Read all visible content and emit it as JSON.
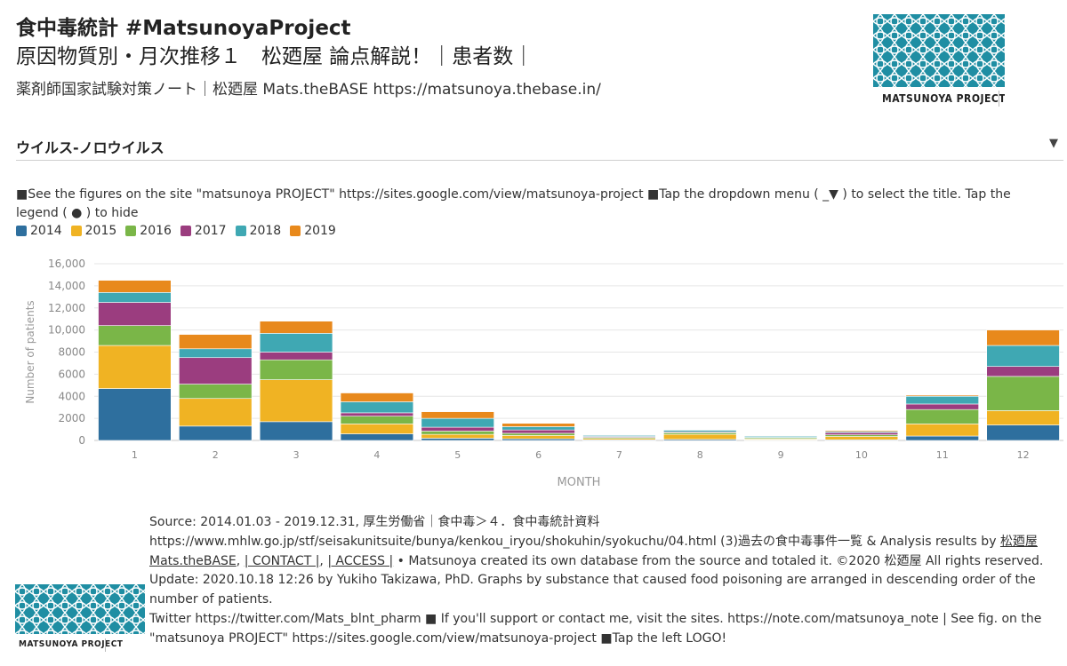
{
  "header": {
    "title1": "食中毒統計 #MatsunoyaProject",
    "title2": "原因物質別・月次推移１　松廼屋 論点解説！｜患者数｜",
    "subtitle": "薬剤師国家試験対策ノート｜松廼屋 Mats.theBASE https://matsunoya.thebase.in/"
  },
  "logo": {
    "text": "MATSUNOYA PROJECT"
  },
  "dropdown": {
    "selected": "ウイルス-ノロウイルス",
    "arrow": "▼"
  },
  "note": "■See the figures on the site \"matsunoya PROJECT\" https://sites.google.com/view/matsunoya-project ■Tap the dropdown menu ( _▼ ) to select the title. Tap the legend ( ● ) to hide",
  "chart_data": {
    "type": "bar",
    "stacked": true,
    "xlabel": "MONTH",
    "ylabel": "Number of patients",
    "ylim": [
      0,
      16000
    ],
    "yticks": [
      "0",
      "2000",
      "4000",
      "6000",
      "8000",
      "10,000",
      "12,000",
      "14,000",
      "16,000"
    ],
    "categories": [
      "1",
      "2",
      "3",
      "4",
      "5",
      "6",
      "7",
      "8",
      "9",
      "10",
      "11",
      "12"
    ],
    "grid": true,
    "legend_position": "top-left",
    "series": [
      {
        "name": "2014",
        "color": "#2e6f9e",
        "values": [
          4700,
          1300,
          1700,
          600,
          200,
          150,
          60,
          100,
          50,
          60,
          400,
          1400
        ]
      },
      {
        "name": "2015",
        "color": "#f0b323",
        "values": [
          3900,
          2500,
          3800,
          900,
          350,
          300,
          120,
          450,
          80,
          300,
          1100,
          1300
        ]
      },
      {
        "name": "2016",
        "color": "#7ab648",
        "values": [
          1800,
          1300,
          1800,
          700,
          300,
          200,
          100,
          150,
          100,
          150,
          1300,
          3100
        ]
      },
      {
        "name": "2017",
        "color": "#9b3d7f",
        "values": [
          2100,
          2400,
          700,
          300,
          350,
          300,
          80,
          80,
          50,
          200,
          500,
          900
        ]
      },
      {
        "name": "2018",
        "color": "#3fa8b3",
        "values": [
          900,
          800,
          1700,
          1000,
          800,
          300,
          100,
          150,
          100,
          100,
          700,
          1900
        ]
      },
      {
        "name": "2019",
        "color": "#e8891c",
        "values": [
          1100,
          1300,
          1100,
          800,
          600,
          300,
          50,
          50,
          50,
          100,
          100,
          1400
        ]
      }
    ]
  },
  "source": {
    "line1": "Source: 2014.01.03 - 2019.12.31, 厚生労働省｜食中毒＞４．食中毒統計資料",
    "line2a": "https://www.mhlw.go.jp/stf/seisakunitsuite/bunya/kenkou_iryou/shokuhin/syokuchu/04.html (3)過去の食中毒事件一覧 & Analysis results by ",
    "line2_link": "松廼屋 Mats.theBASE",
    "link_contact": "| CONTACT |",
    "link_access": "| ACCESS |",
    "line2b": " • Matsunoya created its own database from the source and totaled it. ©2020 松廼屋 All rights reserved.",
    "line3": "Update: 2020.10.18 12:26 by Yukiho Takizawa, PhD. Graphs by substance that caused food poisoning are arranged in descending order of the number of patients.",
    "line4": "Twitter https://twitter.com/Mats_blnt_pharm ■ If you'll support or contact me, visit the sites. https://note.com/matsunoya_note | See fig. on the \"matsunoya PROJECT\" https://sites.google.com/view/matsunoya-project ■Tap the left LOGO!"
  }
}
